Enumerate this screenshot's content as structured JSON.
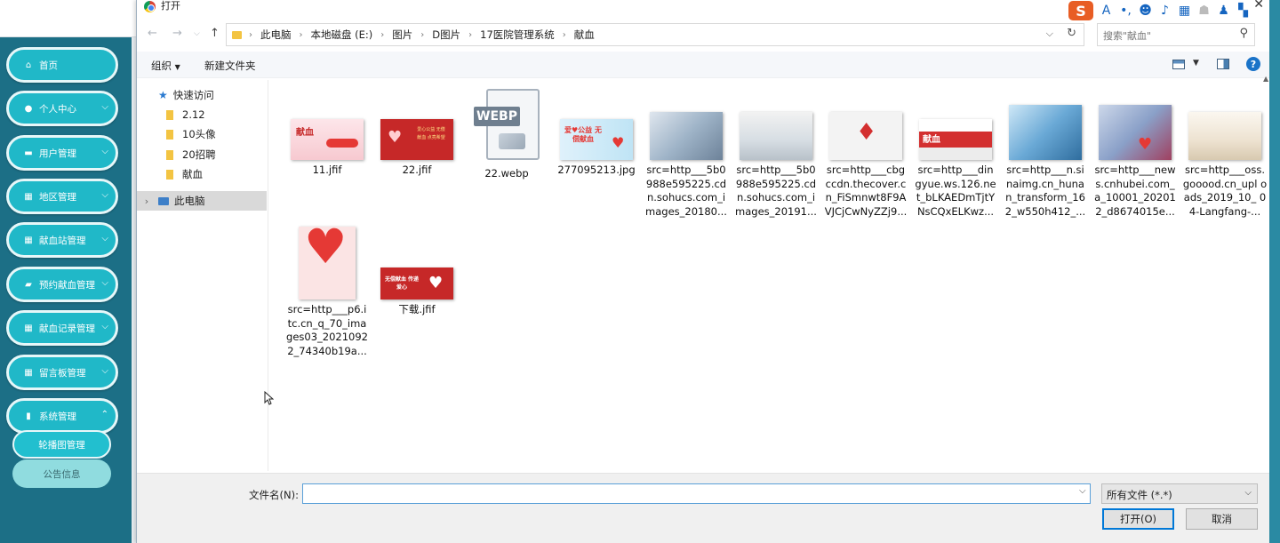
{
  "app": {
    "nav": [
      {
        "label": "首页",
        "icon": "home-icon",
        "has_chevron": false
      },
      {
        "label": "个人中心",
        "icon": "user-icon",
        "has_chevron": true
      },
      {
        "label": "用户管理",
        "icon": "monitor-icon",
        "has_chevron": true
      },
      {
        "label": "地区管理",
        "icon": "grid-icon",
        "has_chevron": true
      },
      {
        "label": "献血站管理",
        "icon": "grid-icon",
        "has_chevron": true
      },
      {
        "label": "预约献血管理",
        "icon": "chat-icon",
        "has_chevron": true
      },
      {
        "label": "献血记录管理",
        "icon": "grid-icon",
        "has_chevron": true
      },
      {
        "label": "留言板管理",
        "icon": "grid-icon",
        "has_chevron": true
      },
      {
        "label": "系统管理",
        "icon": "doc-icon",
        "has_chevron": true
      }
    ],
    "sub_nav": [
      "轮播图管理",
      "公告信息"
    ]
  },
  "dialog": {
    "title": "打开",
    "breadcrumb": [
      "此电脑",
      "本地磁盘 (E:)",
      "图片",
      "D图片",
      "17医院管理系统",
      "献血"
    ],
    "search_placeholder": "搜索\"献血\"",
    "toolbar": {
      "organize": "组织",
      "new_folder": "新建文件夹"
    },
    "nav_pane": {
      "quick_access": "快速访问",
      "folders": [
        "2.12",
        "10头像",
        "20招聘",
        "献血"
      ],
      "this_pc": "此电脑"
    },
    "files": [
      {
        "name": "11.jfif",
        "thumb": "pink-banner"
      },
      {
        "name": "22.jfif",
        "thumb": "red-banner"
      },
      {
        "name": "22.webp",
        "thumb": "webp-doc"
      },
      {
        "name": "277095213.jpg",
        "thumb": "blue-banner"
      },
      {
        "name": "src=http___5b0 988e595225.cd n.sohucs.com_i mages_20180...",
        "thumb": "photo-gray"
      },
      {
        "name": "src=http___5b0 988e595225.cd n.sohucs.com_i mages_20191...",
        "thumb": "room"
      },
      {
        "name": "src=http___cbg ccdn.thecover.c n_FiSmnwt8F9A VJCjCwNyZZj9...",
        "thumb": "drop"
      },
      {
        "name": "src=http___din gyue.ws.126.ne t_bLKAEDmTjtY NsCQxELKwz...",
        "thumb": "bus"
      },
      {
        "name": "src=http___n.si naimg.cn_huna n_transform_16 2_w550h412_...",
        "thumb": "clinic"
      },
      {
        "name": "src=http___new s.cnhubei.com_ a_10001_20201 2_d8674015e...",
        "thumb": "people"
      },
      {
        "name": "src=http___oss. gooood.cn_upl oads_2019_10_ 04-Langfang-...",
        "thumb": "hall"
      },
      {
        "name": "src=http___p6.i tc.cn_q_70_ima ges03_2021092 2_74340b19a...",
        "thumb": "heart"
      },
      {
        "name": "下载.jfif",
        "thumb": "red-banner-2"
      }
    ],
    "thumb_text": {
      "pink": "献血",
      "red": "爱心公益 无偿献血 点亮希望",
      "blue": "爱♥公益 无偿献血",
      "bus": "献血",
      "red2": "无偿献血 传递爱心"
    },
    "filename_label": "文件名(N):",
    "filename_value": "",
    "filetype": "所有文件 (*.*)",
    "open_button": "打开(O)",
    "cancel_button": "取消"
  },
  "colors": {
    "sidebar": "#1c6f86",
    "nav_pill": "#20b8c8",
    "accent": "#0078d7"
  }
}
